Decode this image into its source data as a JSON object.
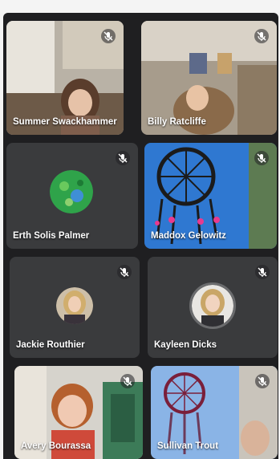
{
  "participants": [
    {
      "name": "Summer Swackhammer",
      "muted": true,
      "video": true
    },
    {
      "name": "Billy Ratcliffe",
      "muted": true,
      "video": true
    },
    {
      "name": "Erth Solis Palmer",
      "muted": true,
      "video": false
    },
    {
      "name": "Maddox Gelowitz",
      "muted": true,
      "video": true
    },
    {
      "name": "Jackie Routhier",
      "muted": true,
      "video": false
    },
    {
      "name": "Kayleen Dicks",
      "muted": true,
      "video": false
    },
    {
      "name": "Avery Bourassa",
      "muted": true,
      "video": true
    },
    {
      "name": "Sullivan Trout",
      "muted": true,
      "video": true
    }
  ],
  "icons": {
    "mic_muted": "mic-off-icon"
  },
  "colors": {
    "background": "#1f1f21",
    "tile": "#3a3b3d",
    "text": "#ffffff"
  }
}
